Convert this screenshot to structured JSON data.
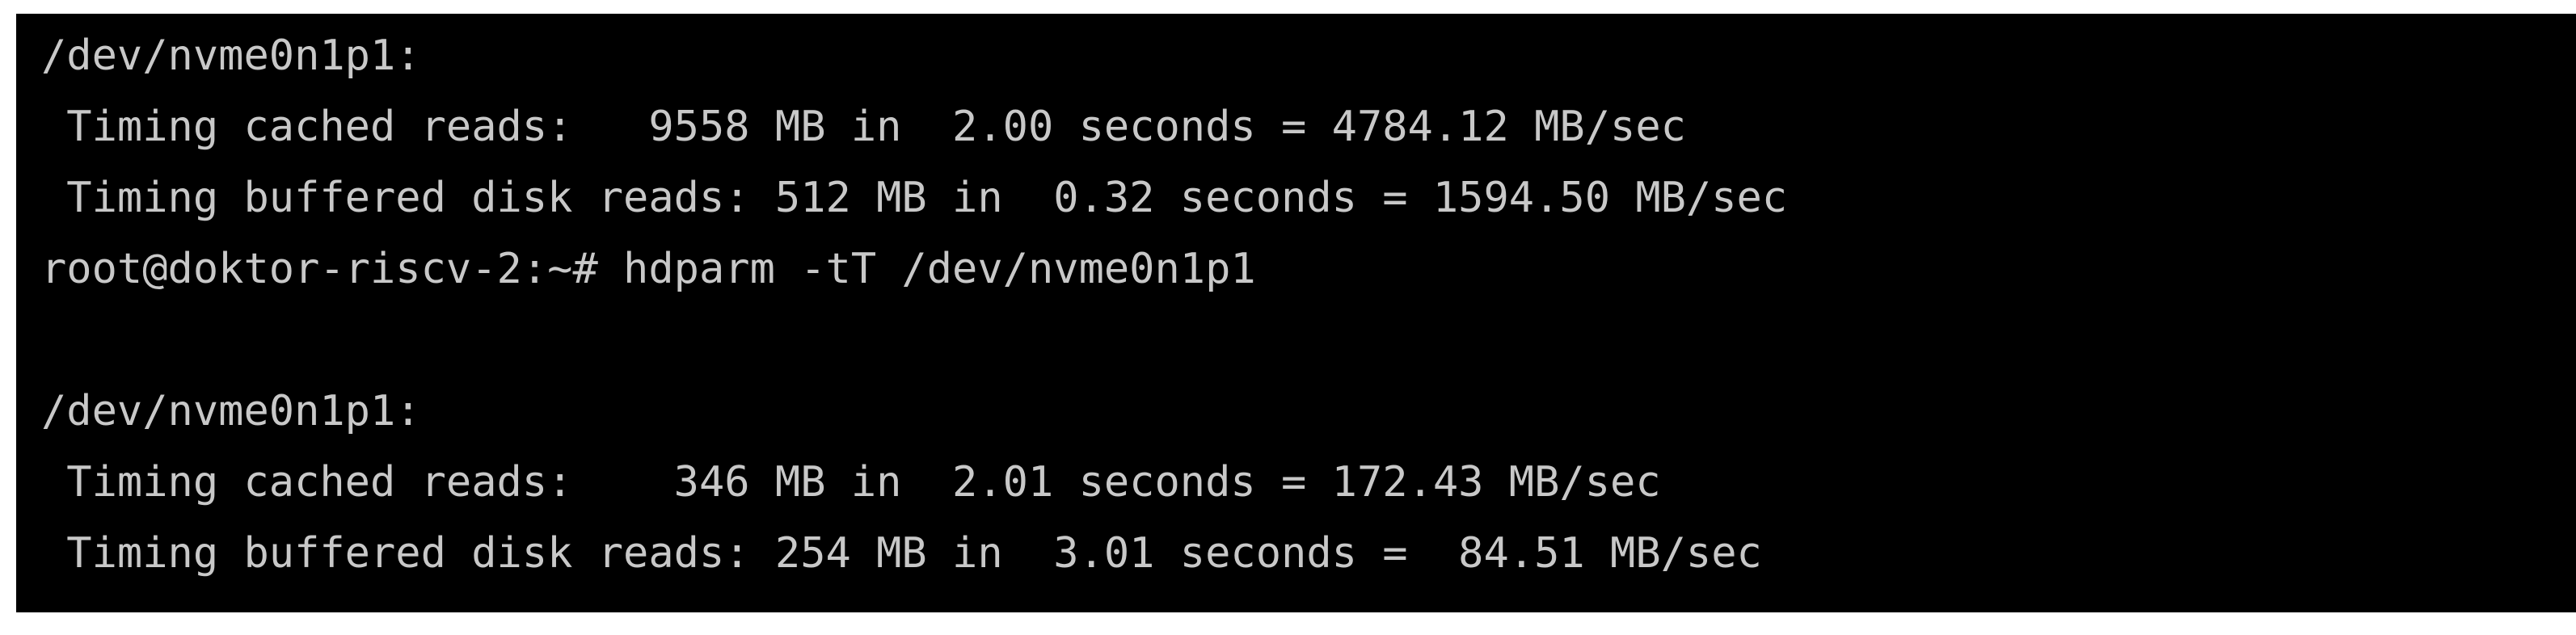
{
  "terminal": {
    "type": "terminal-console",
    "background_color": "#000000",
    "text_color": "#c8c8c8",
    "page_background_color": "#ffffff",
    "hostname": "doktor-riscv-2",
    "user": "root",
    "prompt_symbol": "#",
    "working_directory": "~",
    "device": "/dev/nvme0n1p1",
    "command": "hdparm -tT /dev/nvme0n1p1",
    "lines": [
      {
        "id": "line-1",
        "text": "/dev/nvme0n1p1:",
        "kind": "device-header"
      },
      {
        "id": "line-2",
        "text": " Timing cached reads:   9558 MB in  2.00 seconds = 4784.12 MB/sec",
        "kind": "result-cached-reads"
      },
      {
        "id": "line-3",
        "text": " Timing buffered disk reads: 512 MB in  0.32 seconds = 1594.50 MB/sec",
        "kind": "result-buffered-reads"
      },
      {
        "id": "line-4",
        "text": "root@doktor-riscv-2:~# hdparm -tT /dev/nvme0n1p1",
        "kind": "prompt-command"
      },
      {
        "id": "line-5",
        "text": "",
        "kind": "blank"
      },
      {
        "id": "line-6",
        "text": "/dev/nvme0n1p1:",
        "kind": "device-header"
      },
      {
        "id": "line-7",
        "text": " Timing cached reads:    346 MB in  2.01 seconds = 172.43 MB/sec",
        "kind": "result-cached-reads"
      },
      {
        "id": "line-8",
        "text": " Timing buffered disk reads: 254 MB in  3.01 seconds =  84.51 MB/sec",
        "kind": "result-buffered-reads"
      }
    ],
    "measurements": {
      "run_1": {
        "device": "/dev/nvme0n1p1",
        "cached_reads": {
          "label": "Timing cached reads:",
          "size": "9558 MB",
          "time": "2.00 seconds",
          "throughput": "4784.12 MB/sec"
        },
        "buffered_disk_reads": {
          "label": "Timing buffered disk reads:",
          "size": "512 MB",
          "time": "0.32 seconds",
          "throughput": "1594.50 MB/sec"
        }
      },
      "run_2": {
        "device": "/dev/nvme0n1p1",
        "cached_reads": {
          "label": "Timing cached reads:",
          "size": "346 MB",
          "time": "2.01 seconds",
          "throughput": "172.43 MB/sec"
        },
        "buffered_disk_reads": {
          "label": "Timing buffered disk reads:",
          "size": "254 MB",
          "time": "3.01 seconds",
          "throughput": "84.51 MB/sec"
        }
      }
    }
  }
}
